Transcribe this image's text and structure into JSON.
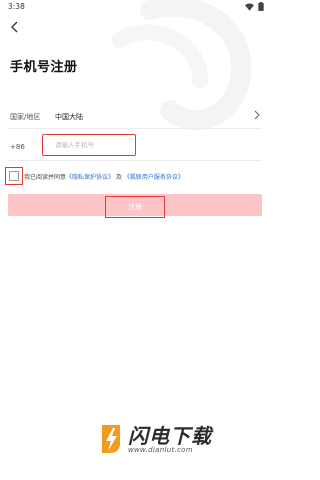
{
  "status_bar": {
    "time": "3:38",
    "wifi_icon": "wifi-icon",
    "battery_icon": "battery-icon"
  },
  "header": {
    "back_icon": "back-arrow-icon",
    "title": "手机号注册"
  },
  "form": {
    "region_label": "国家/地区",
    "region_value": "中国大陆",
    "region_chevron_icon": "chevron-right-icon",
    "country_code": "+86",
    "phone_placeholder": "请输入手机号",
    "phone_value": ""
  },
  "agreement": {
    "checked": false,
    "text_prefix": "我已阅读并同意",
    "privacy_link": "《隐私保护协议》",
    "and_text": " 及 ",
    "service_link": "《狐联用户服务协议》"
  },
  "register": {
    "label": "注册",
    "bar_color": "#fcc6c8"
  },
  "watermark": {
    "brand": "闪电下载",
    "url": "www.dianlut.com",
    "logo_icon": "lightning-logo-icon"
  },
  "colors": {
    "highlight": "#e53935",
    "link": "#2f6fd0"
  }
}
